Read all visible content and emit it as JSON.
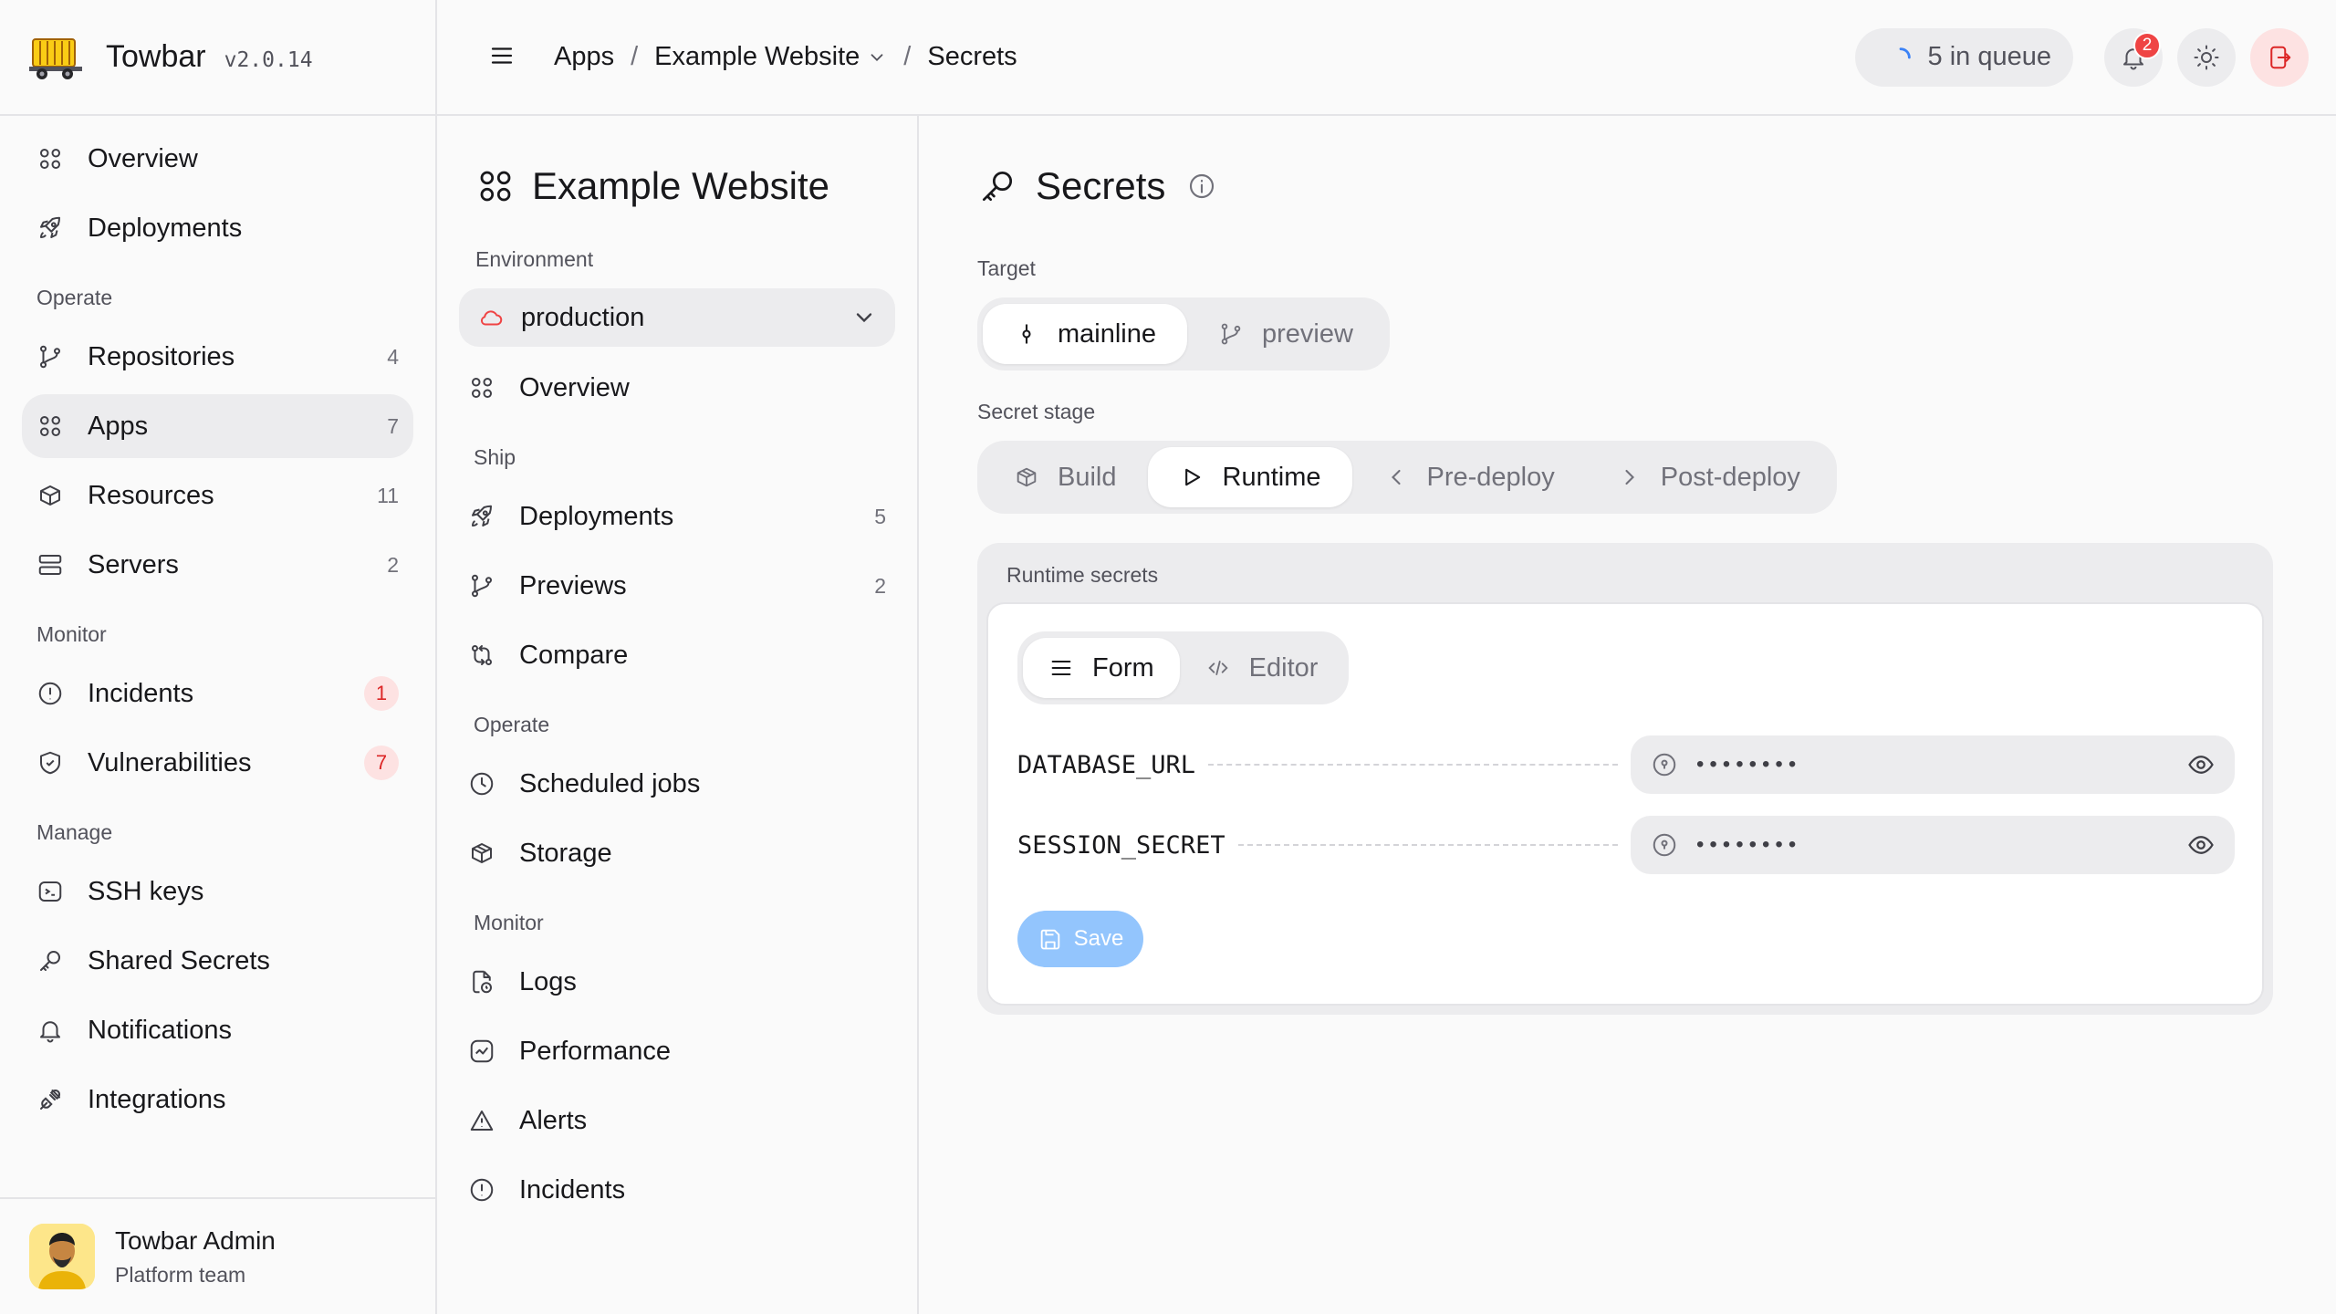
{
  "brand": {
    "name": "Towbar",
    "version": "v2.0.14"
  },
  "sidebar": {
    "top_items": [
      {
        "label": "Overview",
        "icon": "grid-icon"
      },
      {
        "label": "Deployments",
        "icon": "rocket-icon"
      }
    ],
    "sections": [
      {
        "title": "Operate",
        "items": [
          {
            "label": "Repositories",
            "count": "4"
          },
          {
            "label": "Apps",
            "count": "7"
          },
          {
            "label": "Resources",
            "count": "11"
          },
          {
            "label": "Servers",
            "count": "2"
          }
        ]
      },
      {
        "title": "Monitor",
        "items": [
          {
            "label": "Incidents",
            "count": "1"
          },
          {
            "label": "Vulnerabilities",
            "count": "7"
          }
        ]
      },
      {
        "title": "Manage",
        "items": [
          {
            "label": "SSH keys"
          },
          {
            "label": "Shared Secrets"
          },
          {
            "label": "Notifications"
          },
          {
            "label": "Integrations"
          }
        ]
      }
    ],
    "profile": {
      "name": "Towbar Admin",
      "team": "Platform team"
    }
  },
  "topbar": {
    "breadcrumbs": [
      "Apps",
      "Example Website",
      "Secrets"
    ],
    "queue_label": "5 in queue",
    "notification_count": "2"
  },
  "app_nav": {
    "title": "Example Website",
    "environment_label": "Environment",
    "environment_value": "production",
    "overview": "Overview",
    "sections": [
      {
        "title": "Ship",
        "items": [
          {
            "label": "Deployments",
            "count": "5"
          },
          {
            "label": "Previews",
            "count": "2"
          },
          {
            "label": "Compare"
          }
        ]
      },
      {
        "title": "Operate",
        "items": [
          {
            "label": "Scheduled jobs"
          },
          {
            "label": "Storage"
          }
        ]
      },
      {
        "title": "Monitor",
        "items": [
          {
            "label": "Logs"
          },
          {
            "label": "Performance"
          },
          {
            "label": "Alerts"
          },
          {
            "label": "Incidents"
          }
        ]
      }
    ]
  },
  "main": {
    "title": "Secrets",
    "target_label": "Target",
    "targets": [
      "mainline",
      "preview"
    ],
    "stage_label": "Secret stage",
    "stages": [
      "Build",
      "Runtime",
      "Pre-deploy",
      "Post-deploy"
    ],
    "panel_title": "Runtime secrets",
    "modes": [
      "Form",
      "Editor"
    ],
    "secrets": [
      {
        "key": "DATABASE_URL",
        "masked": "••••••••"
      },
      {
        "key": "SESSION_SECRET",
        "masked": "••••••••"
      }
    ],
    "save_label": "Save"
  },
  "colors": {
    "accent": "#93c5fd",
    "danger": "#dc2626",
    "badge_bg": "#fde2e2"
  }
}
